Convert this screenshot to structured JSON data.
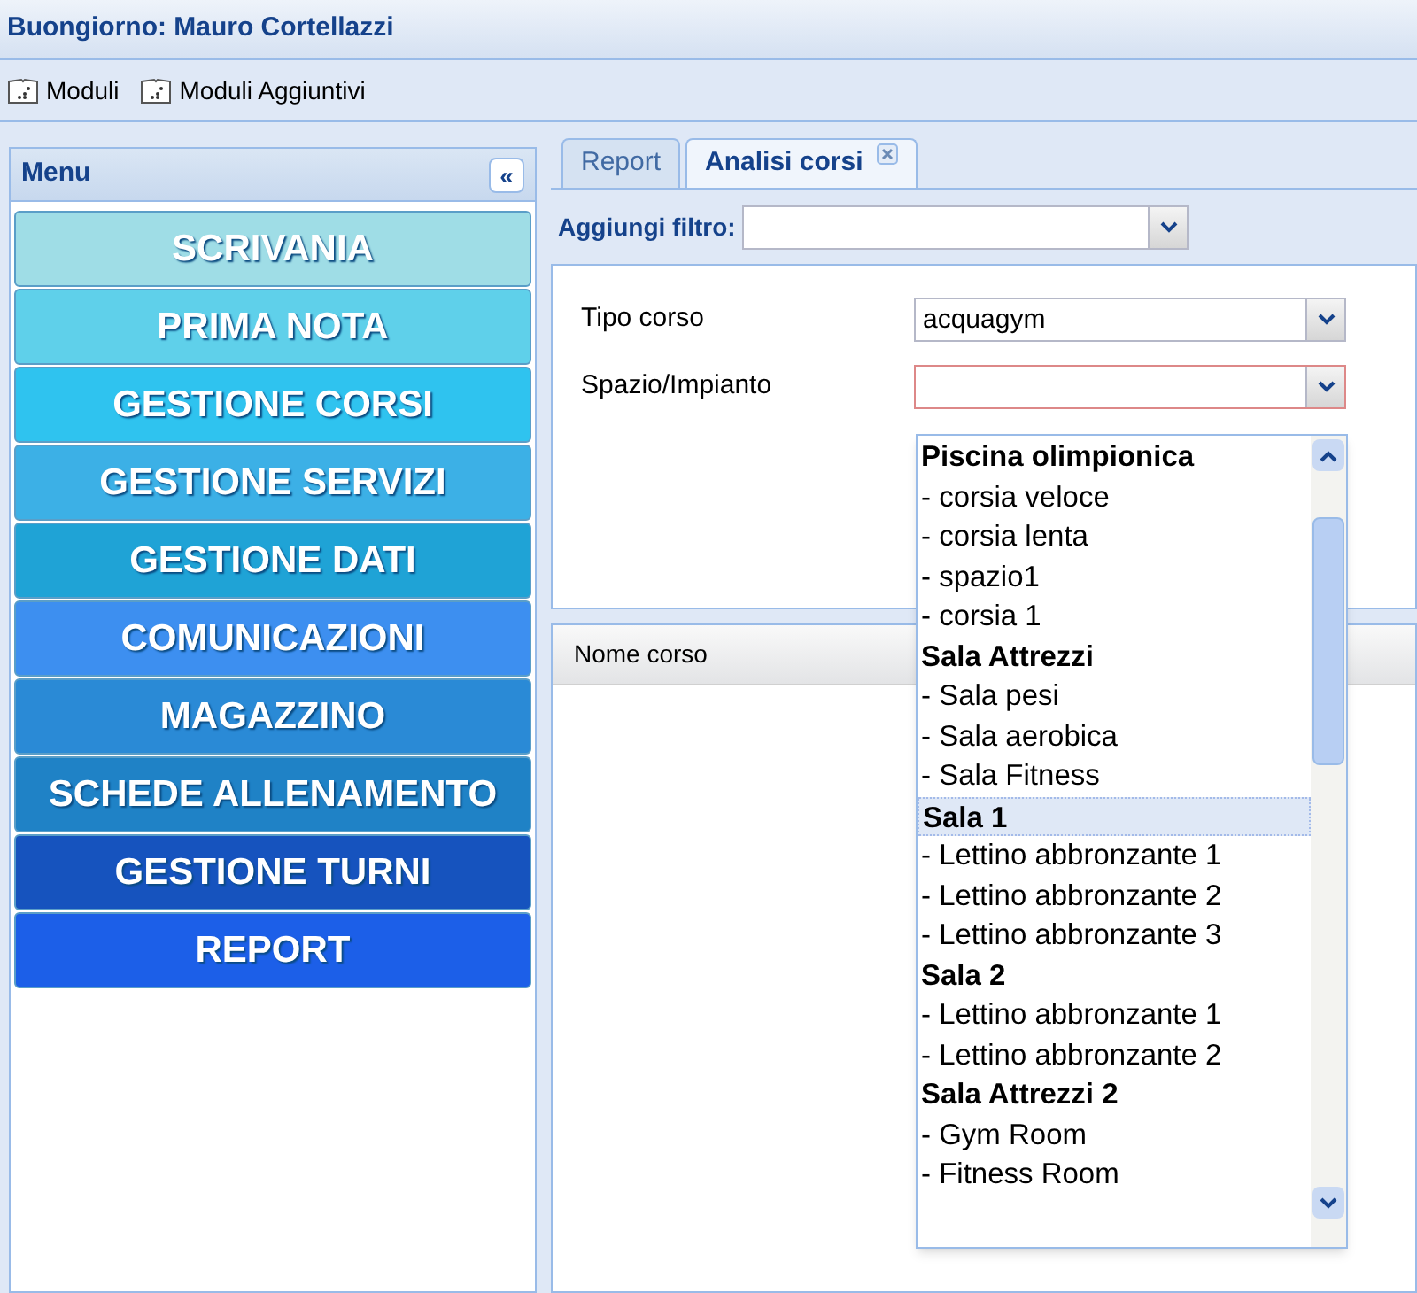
{
  "header": {
    "greeting": "Buongiorno: Mauro Cortellazzi"
  },
  "toolbar": [
    {
      "label": "Moduli"
    },
    {
      "label": "Moduli Aggiuntivi"
    }
  ],
  "menu": {
    "title": "Menu",
    "collapse": "«",
    "items": [
      {
        "label": "SCRIVANIA",
        "color": "#9fdde6"
      },
      {
        "label": "PRIMA NOTA",
        "color": "#5fd0ea"
      },
      {
        "label": "GESTIONE CORSI",
        "color": "#2fc3ef"
      },
      {
        "label": "GESTIONE SERVIZI",
        "color": "#3cb0e6"
      },
      {
        "label": "GESTIONE DATI",
        "color": "#1fa3d6"
      },
      {
        "label": "COMUNICAZIONI",
        "color": "#3d8ff0"
      },
      {
        "label": "MAGAZZINO",
        "color": "#2a8ad6"
      },
      {
        "label": "SCHEDE ALLENAMENTO",
        "color": "#1f82c6"
      },
      {
        "label": "GESTIONE TURNI",
        "color": "#1653be"
      },
      {
        "label": "REPORT",
        "color": "#1c5fe8"
      }
    ]
  },
  "tabs": [
    {
      "label": "Report",
      "selected": false,
      "closable": false
    },
    {
      "label": "Analisi corsi",
      "selected": true,
      "closable": true
    }
  ],
  "filter": {
    "label": "Aggiungi filtro:"
  },
  "form": [
    {
      "label": "Tipo corso",
      "value": "acquagym",
      "invalid": false
    },
    {
      "label": "Spazio/Impianto",
      "invalid": true
    }
  ],
  "grid": {
    "columns": [
      "Nome corso"
    ]
  },
  "dropdown": {
    "options": [
      {
        "kind": "group",
        "label": "Piscina olimpionica",
        "selected": false
      },
      {
        "kind": "item",
        "label": "- corsia veloce",
        "selected": false
      },
      {
        "kind": "item",
        "label": "- corsia lenta",
        "selected": false
      },
      {
        "kind": "item",
        "label": "- spazio1",
        "selected": false
      },
      {
        "kind": "item",
        "label": "- corsia 1",
        "selected": false
      },
      {
        "kind": "group",
        "label": "Sala Attrezzi",
        "selected": false
      },
      {
        "kind": "item",
        "label": "- Sala pesi",
        "selected": false
      },
      {
        "kind": "item",
        "label": "- Sala aerobica",
        "selected": false
      },
      {
        "kind": "item",
        "label": "- Sala Fitness",
        "selected": false
      },
      {
        "kind": "group",
        "label": "Sala 1",
        "selected": true
      },
      {
        "kind": "item",
        "label": "- Lettino abbronzante 1",
        "selected": false
      },
      {
        "kind": "item",
        "label": "- Lettino abbronzante 2",
        "selected": false
      },
      {
        "kind": "item",
        "label": "- Lettino abbronzante 3",
        "selected": false
      },
      {
        "kind": "group",
        "label": "Sala 2",
        "selected": false
      },
      {
        "kind": "item",
        "label": "- Lettino abbronzante 1",
        "selected": false
      },
      {
        "kind": "item",
        "label": "- Lettino abbronzante 2",
        "selected": false
      },
      {
        "kind": "group",
        "label": "Sala Attrezzi 2",
        "selected": false
      },
      {
        "kind": "item",
        "label": "- Gym Room",
        "selected": false
      },
      {
        "kind": "item",
        "label": "- Fitness Room",
        "selected": false
      }
    ]
  }
}
